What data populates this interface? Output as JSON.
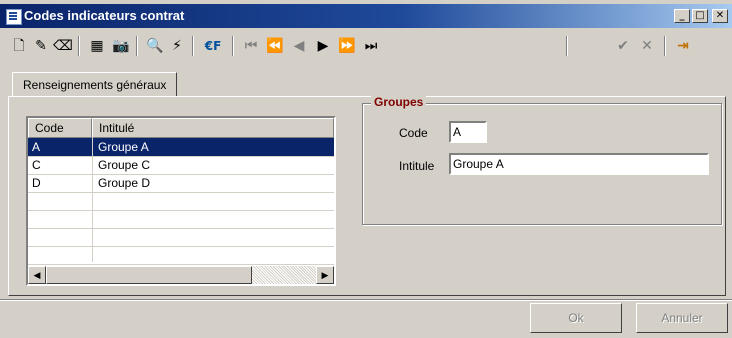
{
  "window": {
    "title": "Codes indicateurs contrat"
  },
  "titlebar_buttons": [
    {
      "name": "minimize-button",
      "glyph": "_"
    },
    {
      "name": "maximize-button",
      "glyph": "□"
    },
    {
      "name": "close-button",
      "glyph": "✕"
    }
  ],
  "toolbar": {
    "icons": {
      "new": "🗋",
      "edit": "✎",
      "erase": "⌫",
      "table": "▦",
      "camera": "📷",
      "binoculars": "🔍",
      "lightning": "⚡",
      "euro": "€F",
      "first": "⏮",
      "rewind": "⏪",
      "prev": "◀",
      "next": "▶",
      "fast_forward": "⏩",
      "last": "⏭",
      "validate": "✔",
      "cancel": "✕",
      "exit": "⇥"
    }
  },
  "tabs": [
    {
      "label": "Renseignements généraux"
    }
  ],
  "grid": {
    "columns": [
      "Code",
      "Intitulé"
    ],
    "rows": [
      {
        "code": "A",
        "intitule": "Groupe A",
        "selected": true
      },
      {
        "code": "C",
        "intitule": "Groupe C",
        "selected": false
      },
      {
        "code": "D",
        "intitule": "Groupe D",
        "selected": false
      }
    ]
  },
  "groupes": {
    "legend": "Groupes",
    "code_label": "Code",
    "code_value": "A",
    "intitule_label": "Intitule",
    "intitule_value": "Groupe A"
  },
  "buttons": {
    "ok": "Ok",
    "annuler": "Annuler"
  },
  "colors": {
    "titlebar": "#0a246a",
    "selection": "#0a246a",
    "legend": "#800000"
  }
}
